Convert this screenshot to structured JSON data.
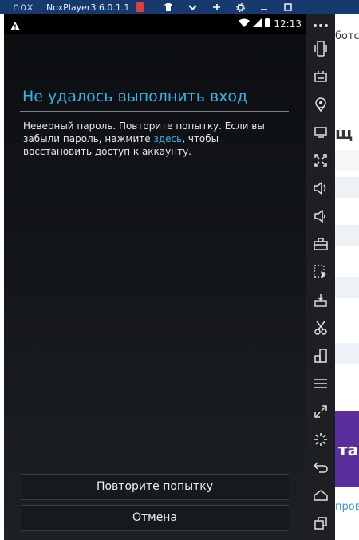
{
  "window": {
    "title": "NoxPlayer3 6.0.1.1",
    "logo_text": "nox",
    "alert_badge": "!"
  },
  "status_bar": {
    "time": "12:13"
  },
  "dialog": {
    "title": "Не удалось выполнить вход",
    "message_before": "Неверный пароль. Повторите попытку. Если вы забыли пароль, нажмите ",
    "link_text": "здесь",
    "message_after": ", чтобы восстановить доступ к аккаунту.",
    "retry_label": "Повторите попытку",
    "cancel_label": "Отмена"
  },
  "background_page": {
    "snippet_top": "ботс",
    "snippet_heading": "щ",
    "snippet_purple": "та",
    "snippet_bottom": "пров"
  },
  "sidebar_icons": [
    "more-icon",
    "shake-icon",
    "keyboard-icon",
    "location-icon",
    "screen-icon",
    "fullscreen-icon",
    "volume-up-icon",
    "volume-down-icon",
    "toolbox-icon",
    "add-apk-icon",
    "apk-icon",
    "scissors-icon",
    "multi-instance-icon",
    "menu-icon",
    "resize-icon",
    "loading-icon",
    "back-icon",
    "home-icon",
    "recent-apps-icon"
  ],
  "colors": {
    "accent": "#33b5e5",
    "titlebar": "#163a6e",
    "sidebar": "#1e1f23"
  }
}
